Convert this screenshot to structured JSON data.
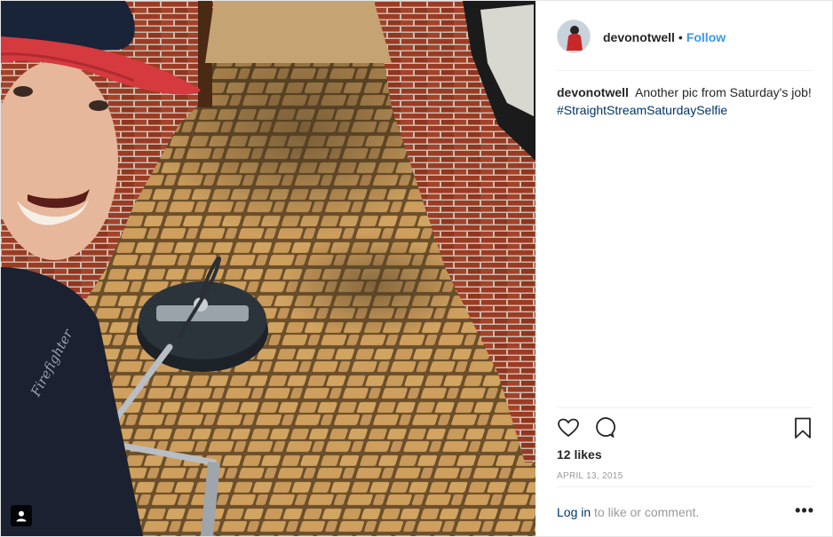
{
  "post": {
    "author": {
      "username": "devonotwell",
      "follow_label": "Follow",
      "separator": "•",
      "avatar": "avatar-person-red-jacket"
    },
    "caption": {
      "username": "devonotwell",
      "text": "Another pic from Saturday's job!",
      "hashtag": "#StraightStreamSaturdaySelfie"
    },
    "likes_text": "12 likes",
    "date_text": "APRIL 13, 2015",
    "comment_prompt": {
      "login_label": "Log in",
      "rest": " to like or comment."
    },
    "more_label": "•••",
    "photo": {
      "description_icon": "person-tag-icon",
      "shirt_text": "Firefighter"
    }
  },
  "colors": {
    "link_blue": "#3897f0",
    "hashtag_navy": "#003569",
    "text": "#262626",
    "muted": "#999999"
  }
}
